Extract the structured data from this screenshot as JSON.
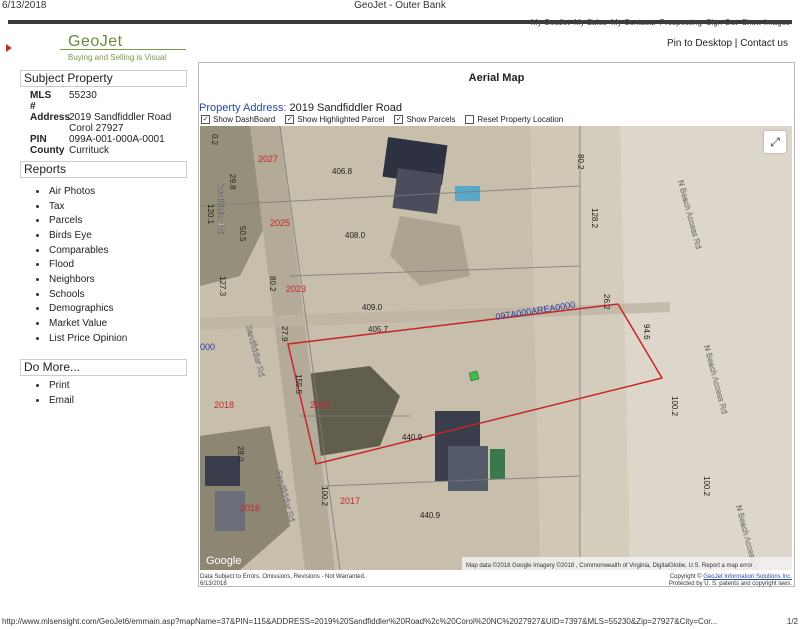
{
  "print_header": {
    "date": "6/13/2018",
    "title": "GeoJet - Outer Bank"
  },
  "top_nav": [
    "My GeoJet",
    "My Sales",
    "My Contacts",
    "Prospecting",
    "Sign Out",
    "Show Images"
  ],
  "logo": {
    "name": "GeoJet",
    "tagline": "Buying and Selling is Visual"
  },
  "pin_links": {
    "pin": "Pin to Desktop",
    "sep": "|",
    "contact": "Contact us"
  },
  "subject": {
    "heading": "Subject Property",
    "fields": [
      {
        "key": "MLS #",
        "value": "55230"
      },
      {
        "key": "Address",
        "value": "2019 Sandfiddler Road"
      },
      {
        "key": "",
        "value": "Corol 27927"
      },
      {
        "key": "PIN",
        "value": "099A-001-000A-0001"
      },
      {
        "key": "County",
        "value": "Currituck"
      }
    ]
  },
  "reports": {
    "heading": "Reports",
    "items": [
      "Air Photos",
      "Tax",
      "Parcels",
      "Birds Eye",
      "Comparables",
      "Flood",
      "Neighbors",
      "Schools",
      "Demographics",
      "Market Value",
      "List Price Opinion"
    ]
  },
  "domore": {
    "heading": "Do More...",
    "items": [
      "Print",
      "Email"
    ]
  },
  "map_panel": {
    "title": "Aerial Map",
    "address_label": "Property Address:",
    "address_value": "2019 Sandfiddler Road",
    "checks": [
      {
        "label": "Show DashBoard",
        "checked": true
      },
      {
        "label": "Show Highlighted Parcel",
        "checked": true
      },
      {
        "label": "Show Parcels",
        "checked": true
      },
      {
        "label": "Reset Property Location",
        "checked": false
      }
    ],
    "map_labels": {
      "parcel_id": "097A000AREA0000",
      "lots": [
        "2027",
        "2025",
        "2023",
        "2019",
        "2018",
        "2016",
        "2017"
      ],
      "dimensions": [
        "406.8",
        "408.0",
        "409.0",
        "405.7",
        "440.9",
        "440.9",
        "80.2",
        "80.2",
        "128.2",
        "26.2",
        "94.6",
        "100.2",
        "100.2",
        "100.2",
        "155.5",
        "127.3",
        "120.1",
        "29.8",
        "50.5",
        "27.9",
        "28.0",
        "0.2"
      ],
      "roads": [
        "Sandfiddler Rd",
        "Sandfiddler Rd",
        "Sandfiddler Rd",
        "N Beach Access Rd",
        "N Beach Access Rd",
        "N Beach Access Rd"
      ],
      "left_edge": "000",
      "google": "Google",
      "attribution": "Map data ©2018 Google Imagery ©2018 , Commonwealth of Virginia, DigitalGlobe, U.S. Report a map error"
    }
  },
  "footer": {
    "left1": "Data Subject to Errors, Omissions, Revisions - Not Warranted.",
    "left2": "6/13/2018",
    "right1": "Copyright ©",
    "right_link": "GeoJet Information Solutions Inc.",
    "right2": "Protected by U. S. patents and copyright laws."
  },
  "print_footer": {
    "url": "http://www.mlsensight.com/GeoJet6/emmain.asp?mapName=37&PIN=115&ADDRESS=2019%20Sandfiddler%20Road%2c%20Corol%20NC%2027927&UID=7397&MLS=55230&Zip=27927&City=Cor...",
    "page": "1/2"
  }
}
